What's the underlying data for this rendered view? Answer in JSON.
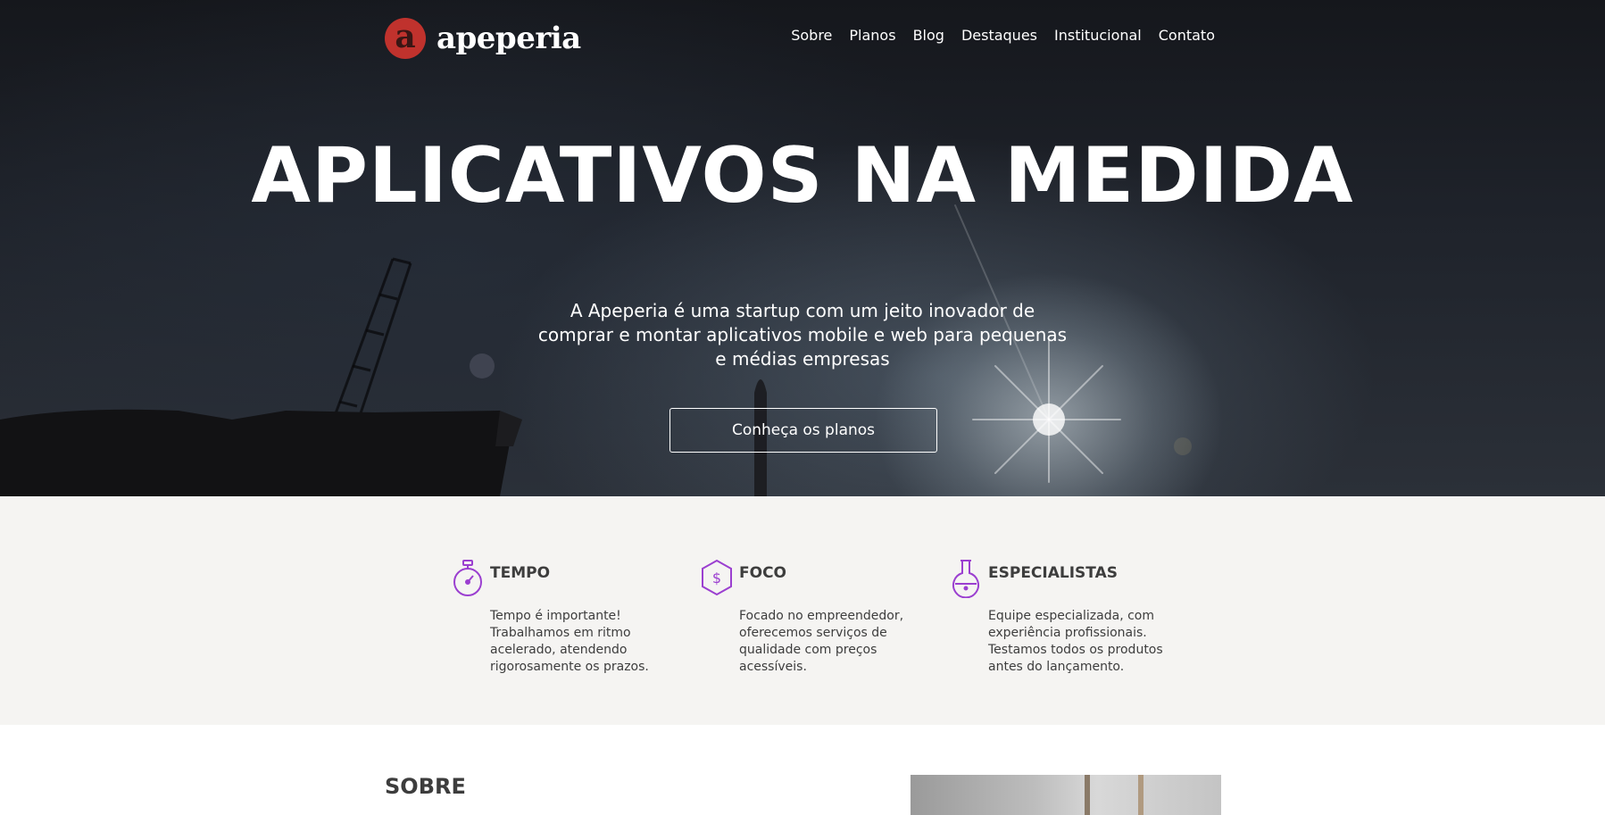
{
  "brand": {
    "logo_letter": "a",
    "name": "apeperia",
    "logo_color": "#c0322d"
  },
  "nav": {
    "items": [
      "Sobre",
      "Planos",
      "Blog",
      "Destaques",
      "Institucional",
      "Contato"
    ]
  },
  "hero": {
    "title": "APLICATIVOS NA MEDIDA",
    "subtitle": "A Apeperia é uma startup com um jeito inovador de comprar e montar aplicativos mobile e web para pequenas e médias empresas",
    "cta_label": "Conheça os planos"
  },
  "features": {
    "accent_color": "#9b3fd0",
    "items": [
      {
        "icon": "stopwatch-icon",
        "title": "TEMPO",
        "text": "Tempo é importante! Trabalhamos em ritmo acelerado, atendendo rigorosamente os prazos."
      },
      {
        "icon": "dollar-hexagon-icon",
        "title": "FOCO",
        "text": "Focado no empreendedor, oferecemos serviços de qualidade com preços acessíveis."
      },
      {
        "icon": "flask-icon",
        "title": "ESPECIALISTAS",
        "text": "Equipe especializada, com experiência profissionais. Testamos todos os produtos antes do lançamento."
      }
    ]
  },
  "about": {
    "title": "SOBRE"
  }
}
